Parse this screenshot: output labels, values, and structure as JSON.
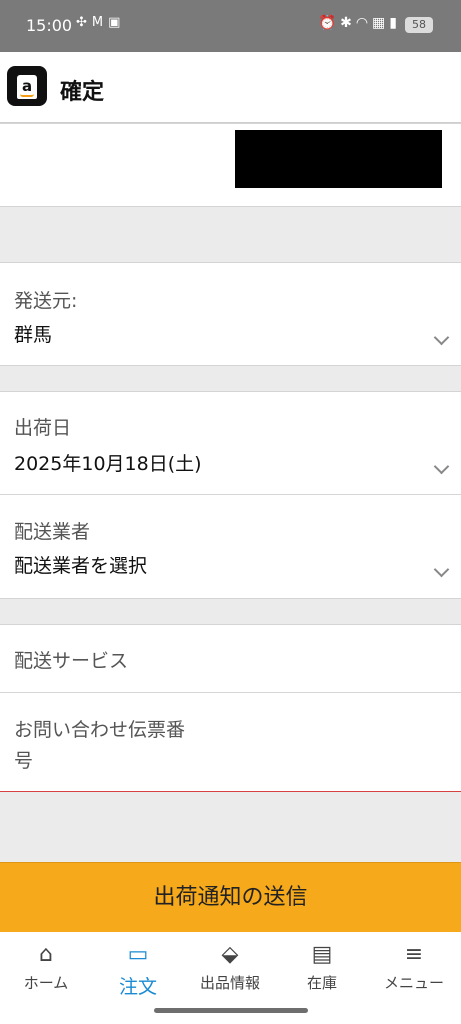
{
  "status_bar": {
    "time": "15:00",
    "left_icons": [
      "pinwheel-icon",
      "gmail-icon",
      "gallery-icon"
    ],
    "right_icons": [
      "alarm-icon",
      "bluetooth-icon",
      "wifi-icon",
      "volte-icon",
      "signal-icon"
    ],
    "battery": "58"
  },
  "app_bar": {
    "title": "確定",
    "logo_letter": "a"
  },
  "form": {
    "ship_from": {
      "label": "発送元:",
      "value": "群馬"
    },
    "ship_date": {
      "label": "出荷日",
      "value": "2025年10月18日(土)"
    },
    "carrier": {
      "label": "配送業者",
      "value": "配送業者を選択"
    },
    "service": {
      "label": "配送サービス"
    },
    "tracking": {
      "label_line1": "お問い合わせ伝票番",
      "label_line2": "号"
    }
  },
  "submit_button": {
    "label": "出荷通知の送信"
  },
  "bottom_nav": {
    "items": [
      {
        "label": "ホーム",
        "icon": "home-icon",
        "glyph": "⌂",
        "active": false
      },
      {
        "label": "注文",
        "icon": "box-icon",
        "glyph": "▭",
        "active": true
      },
      {
        "label": "出品情報",
        "icon": "tag-icon",
        "glyph": "⬙",
        "active": false
      },
      {
        "label": "在庫",
        "icon": "clipboard-icon",
        "glyph": "▤",
        "active": false
      },
      {
        "label": "メニュー",
        "icon": "menu-icon",
        "glyph": "≡",
        "active": false
      }
    ]
  },
  "colors": {
    "accent_button": "#f6a91b",
    "active_nav": "#1a8ad4",
    "status_bar": "#7a7a7a"
  }
}
